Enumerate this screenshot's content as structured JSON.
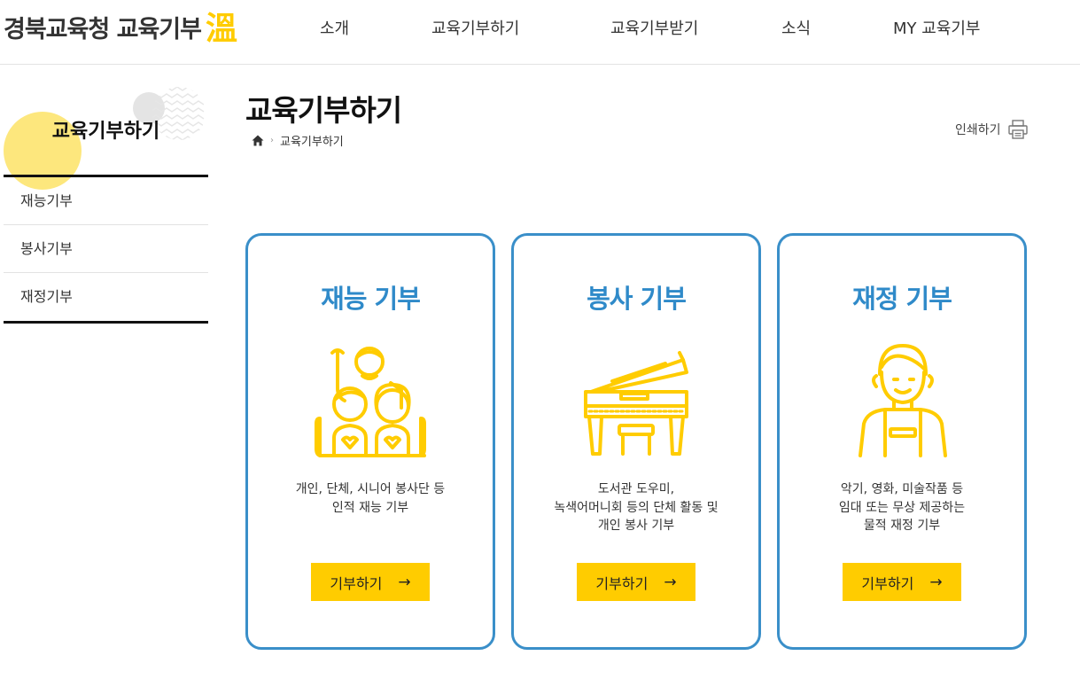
{
  "header": {
    "logo_text": "경북교육청 교육기부",
    "logo_mark_text": "溫",
    "nav": [
      "소개",
      "교육기부하기",
      "교육기부받기",
      "소식",
      "MY 교육기부"
    ]
  },
  "sidebar": {
    "title": "교육기부하기",
    "items": [
      {
        "label": "재능기부"
      },
      {
        "label": "봉사기부"
      },
      {
        "label": "재정기부"
      }
    ]
  },
  "content": {
    "title": "교육기부하기",
    "breadcrumb": {
      "home_icon": "home-icon",
      "current": "교육기부하기"
    },
    "print_label": "인쇄하기"
  },
  "cards": [
    {
      "title": "재능 기부",
      "icon": "family-icon",
      "desc": [
        "개인, 단체, 시니어 봉사단 등",
        "인적 재능 기부"
      ],
      "button": "기부하기"
    },
    {
      "title": "봉사 기부",
      "icon": "piano-icon",
      "desc": [
        "도서관 도우미,",
        "녹색어머니회 등의 단체 활동 및",
        "개인 봉사 기부"
      ],
      "button": "기부하기"
    },
    {
      "title": "재정 기부",
      "icon": "person-icon",
      "desc": [
        "악기, 영화, 미술작품 등",
        "임대 또는 무상 제공하는",
        "물적 재정 기부"
      ],
      "button": "기부하기"
    }
  ],
  "colors": {
    "accent_blue": "#2f8ac9",
    "card_border": "#3a8fc9",
    "button_yellow": "#ffcc00",
    "icon_yellow": "#ffcc00",
    "deco_yellow": "#fde77d"
  }
}
